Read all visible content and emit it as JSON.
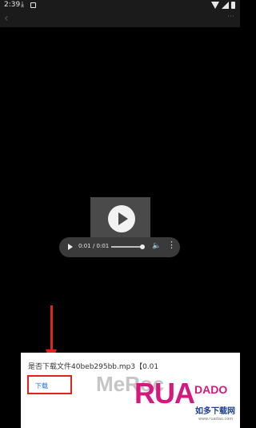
{
  "status_bar": {
    "time": "2:39",
    "icons": [
      "download-icon",
      "notification-icon",
      "wifi-icon",
      "signal-icon",
      "battery-icon"
    ]
  },
  "toolbar": {
    "back_icon": "back-arrow-icon",
    "back_glyph": "‹",
    "more_glyph": "⋯"
  },
  "audio_player": {
    "time_display": "0:01 / 0:01",
    "progress": 1.0,
    "more_glyph": "⋮"
  },
  "download_prompt": {
    "message": "是否下载文件40beb295bb.mp3【0.01",
    "button_label": "下载"
  },
  "watermark": {
    "text": "MeRoc",
    "logo_text": "RUA",
    "logo_dado": "DADO",
    "logo_cn": "如多下载网",
    "logo_url": "www.ruadao.com"
  },
  "colors": {
    "background": "#000000",
    "highlight": "#e0241c",
    "link": "#1a73e8",
    "logo": "#d4187e"
  }
}
